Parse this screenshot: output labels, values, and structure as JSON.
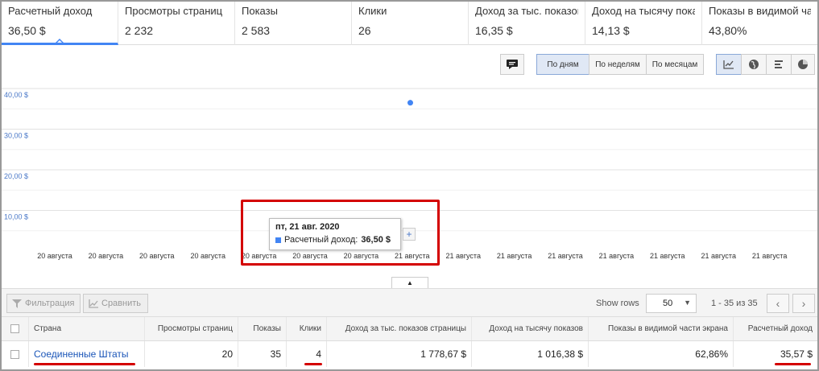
{
  "metrics": [
    {
      "label": "Расчетный доход",
      "value": "36,50 $",
      "active": true
    },
    {
      "label": "Просмотры страниц",
      "value": "2 232"
    },
    {
      "label": "Показы",
      "value": "2 583"
    },
    {
      "label": "Клики",
      "value": "26"
    },
    {
      "label": "Доход за тыс. показов страницы",
      "value": "16,35 $"
    },
    {
      "label": "Доход на тысячу показов",
      "value": "14,13 $"
    },
    {
      "label": "Показы в видимой части экрана",
      "value": "43,80%"
    }
  ],
  "toolbar": {
    "annotation_icon": "comment-icon",
    "period_buttons": [
      "По дням",
      "По неделям",
      "По месяцам"
    ],
    "active_period": "По дням",
    "view_icons": [
      "line-chart-icon",
      "globe-icon",
      "bar-chart-icon",
      "pie-chart-icon"
    ]
  },
  "chart_data": {
    "type": "line",
    "y_ticks": [
      "40,00 $",
      "30,00 $",
      "20,00 $",
      "10,00 $"
    ],
    "ylim": [
      0,
      40
    ],
    "x_ticks": [
      "20 августа",
      "20 августа",
      "20 августа",
      "20 августа",
      "20 августа",
      "20 августа",
      "20 августа",
      "21 августа",
      "21 августа",
      "21 августа",
      "21 августа",
      "21 августа",
      "21 августа",
      "21 августа",
      "21 августа"
    ],
    "series": [
      {
        "values": [
          36.5
        ],
        "color": "#4285f4"
      }
    ],
    "point_x_fraction": 0.5
  },
  "tooltip": {
    "date": "пт, 21 авг. 2020",
    "label": "Расчетный доход:",
    "value": "36,50 $"
  },
  "table_toolbar": {
    "filter_label": "Фильтрация",
    "compare_label": "Сравнить",
    "show_rows_label": "Show rows",
    "rows_value": "50",
    "pagination": "1 - 35 из 35"
  },
  "table": {
    "columns": [
      "Страна",
      "Просмотры страниц",
      "Показы",
      "Клики",
      "Доход за тыс. показов страницы",
      "Доход на тысячу показов",
      "Показы в видимой части экрана",
      "Расчетный доход"
    ],
    "rows": [
      [
        "Соединенные Штаты",
        "20",
        "35",
        "4",
        "1 778,67 $",
        "1 016,38 $",
        "62,86%",
        "35,57 $"
      ]
    ]
  }
}
